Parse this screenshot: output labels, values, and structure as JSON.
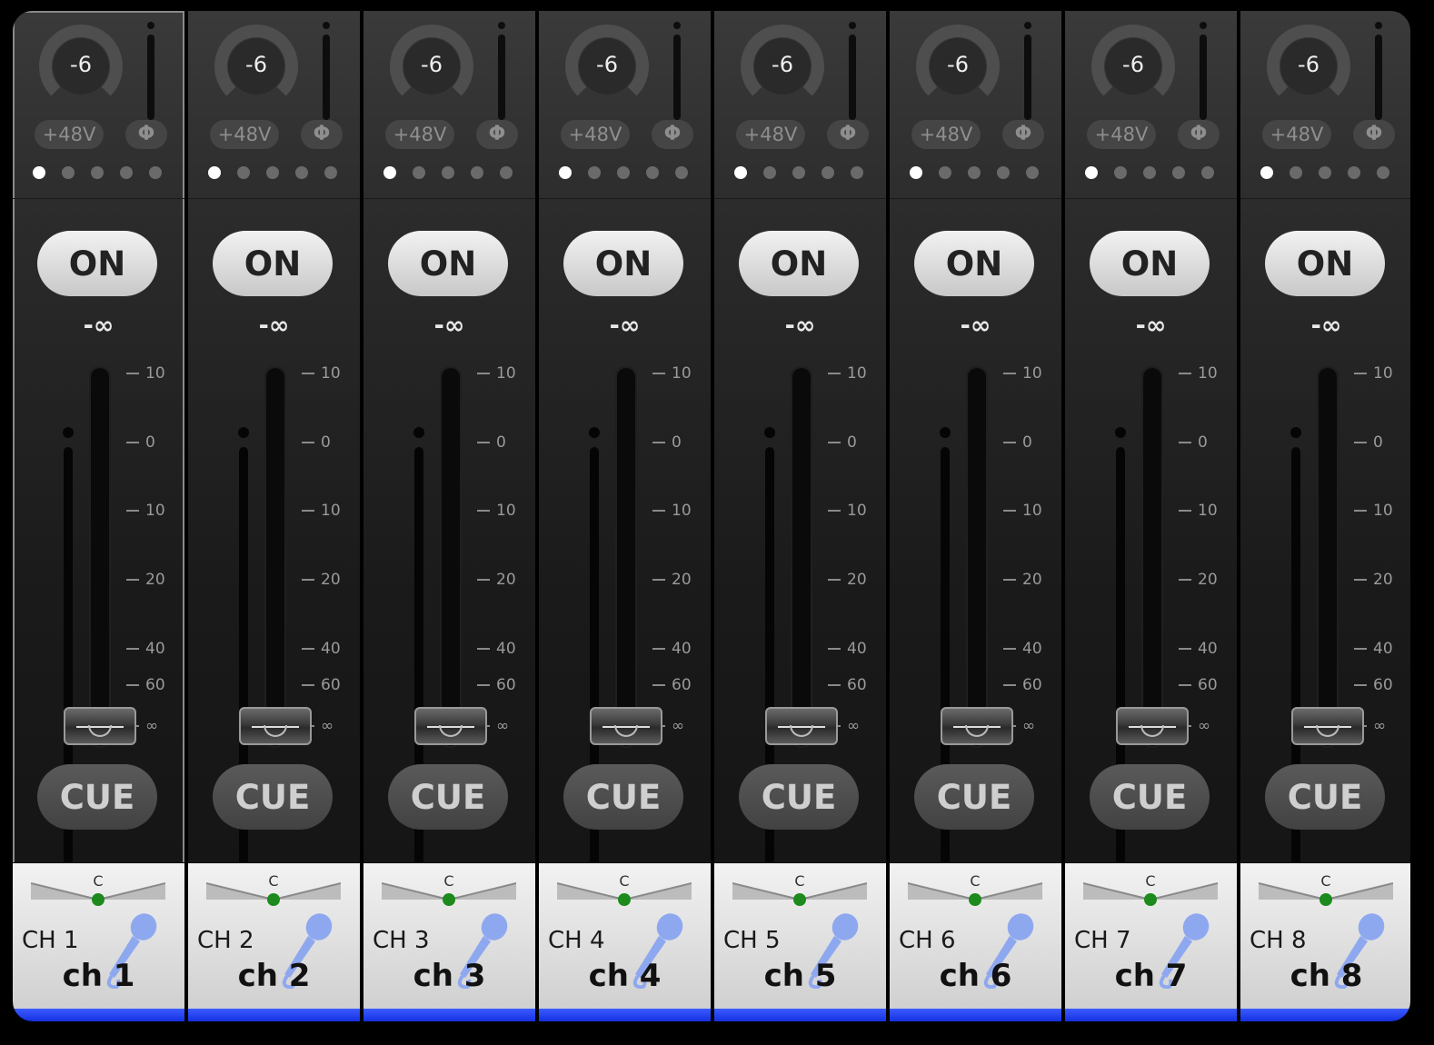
{
  "colors": {
    "strip_bg": "#2d2d2d",
    "on_button": "#e0e0e0",
    "cue_button": "#4a4a4a",
    "label_area": "#e6e6e6",
    "pan_dot": "#1c8a1c",
    "mic_icon": "#8ea8f0",
    "bottom_bar": "#2440f0"
  },
  "fader_scale": [
    {
      "label": "10",
      "db": 10
    },
    {
      "label": "0",
      "db": 0
    },
    {
      "label": "10",
      "db": -10
    },
    {
      "label": "20",
      "db": -20
    },
    {
      "label": "40",
      "db": -40
    },
    {
      "label": "60",
      "db": -60
    },
    {
      "label": "∞",
      "db": -1000
    }
  ],
  "channels": [
    {
      "gain": "-6",
      "phantom": "+48V",
      "phase": "Φ",
      "on": "ON",
      "level": "-∞",
      "cue": "CUE",
      "pan": "C",
      "name": "CH 1",
      "label": "ch 1",
      "fader_db": -1000,
      "page": 0,
      "selected": true
    },
    {
      "gain": "-6",
      "phantom": "+48V",
      "phase": "Φ",
      "on": "ON",
      "level": "-∞",
      "cue": "CUE",
      "pan": "C",
      "name": "CH 2",
      "label": "ch 2",
      "fader_db": -1000,
      "page": 0,
      "selected": false
    },
    {
      "gain": "-6",
      "phantom": "+48V",
      "phase": "Φ",
      "on": "ON",
      "level": "-∞",
      "cue": "CUE",
      "pan": "C",
      "name": "CH 3",
      "label": "ch 3",
      "fader_db": -1000,
      "page": 0,
      "selected": false
    },
    {
      "gain": "-6",
      "phantom": "+48V",
      "phase": "Φ",
      "on": "ON",
      "level": "-∞",
      "cue": "CUE",
      "pan": "C",
      "name": "CH 4",
      "label": "ch 4",
      "fader_db": -1000,
      "page": 0,
      "selected": false
    },
    {
      "gain": "-6",
      "phantom": "+48V",
      "phase": "Φ",
      "on": "ON",
      "level": "-∞",
      "cue": "CUE",
      "pan": "C",
      "name": "CH 5",
      "label": "ch 5",
      "fader_db": -1000,
      "page": 0,
      "selected": false
    },
    {
      "gain": "-6",
      "phantom": "+48V",
      "phase": "Φ",
      "on": "ON",
      "level": "-∞",
      "cue": "CUE",
      "pan": "C",
      "name": "CH 6",
      "label": "ch 6",
      "fader_db": -1000,
      "page": 0,
      "selected": false
    },
    {
      "gain": "-6",
      "phantom": "+48V",
      "phase": "Φ",
      "on": "ON",
      "level": "-∞",
      "cue": "CUE",
      "pan": "C",
      "name": "CH 7",
      "label": "ch 7",
      "fader_db": -1000,
      "page": 0,
      "selected": false
    },
    {
      "gain": "-6",
      "phantom": "+48V",
      "phase": "Φ",
      "on": "ON",
      "level": "-∞",
      "cue": "CUE",
      "pan": "C",
      "name": "CH 8",
      "label": "ch 8",
      "fader_db": -1000,
      "page": 0,
      "selected": false
    }
  ],
  "page_count": 5
}
